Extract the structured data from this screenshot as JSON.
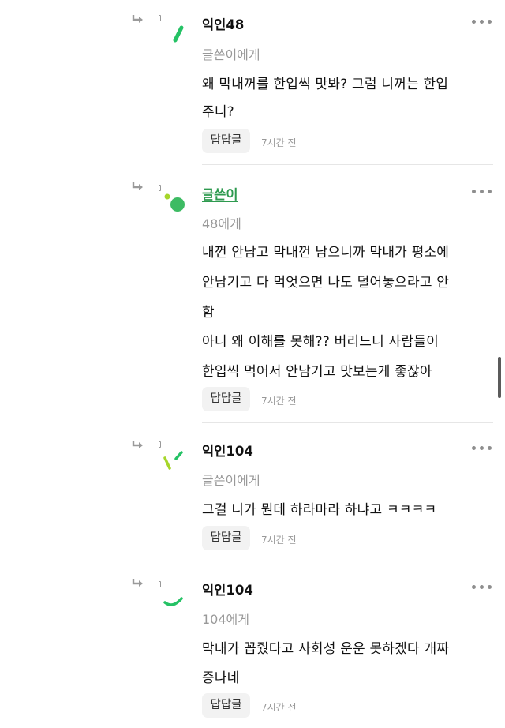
{
  "comments": [
    {
      "author": "익인48",
      "target": "글쓴이에게",
      "lines": [
        "왜 막내꺼를 한입씩 맛봐? 그럼 니꺼는 한입",
        "주니?"
      ],
      "reply_label": "답답글",
      "time": "7시간 전"
    },
    {
      "author": "글쓴이",
      "target": "48에게",
      "lines": [
        "내껀 안남고 막내껀 남으니까 막내가 평소에",
        "안남기고 다 먹엇으면 나도 덜어놓으라고 안",
        "함",
        "아니 왜 이해를 못해?? 버리느니 사람들이",
        "한입씩 먹어서 안남기고 맛보는게 좋잖아"
      ],
      "reply_label": "답답글",
      "time": "7시간 전"
    },
    {
      "author": "익인104",
      "target": "글쓴이에게",
      "lines": [
        "그걸 니가 뭔데 하라마라 하냐고 ㅋㅋㅋㅋ"
      ],
      "reply_label": "답답글",
      "time": "7시간 전"
    },
    {
      "author": "익인104",
      "target": "104에게",
      "lines": [
        "막내가 꼽줬다고 사회성 운운 못하겠다 개짜",
        "증나네"
      ],
      "reply_label": "답답글",
      "time": "7시간 전"
    }
  ],
  "icons": {
    "reply": "reply-arrow-icon",
    "more": "more-options-icon"
  },
  "colors": {
    "author_name": "#2e9a4f",
    "avatar_green": "#25c265",
    "avatar_lime": "#a6d62a",
    "muted_text": "#999999"
  }
}
